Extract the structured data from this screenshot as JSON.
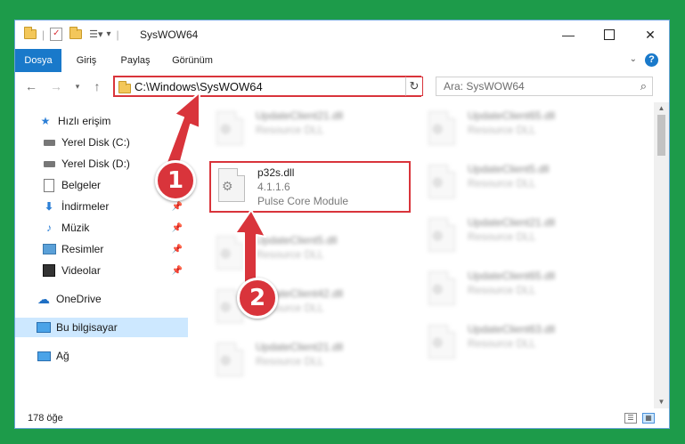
{
  "window": {
    "title": "SysWOW64"
  },
  "ribbon": {
    "tabs": [
      "Dosya",
      "Giriş",
      "Paylaş",
      "Görünüm"
    ],
    "help": "?"
  },
  "address": {
    "path": "C:\\Windows\\SysWOW64"
  },
  "search": {
    "placeholder": "Ara: SysWOW64"
  },
  "sidebar": {
    "items": [
      {
        "label": "Hızlı erişim",
        "icon": "star-icon"
      },
      {
        "label": "Yerel Disk (C:)",
        "icon": "drive-icon"
      },
      {
        "label": "Yerel Disk (D:)",
        "icon": "drive-icon"
      },
      {
        "label": "Belgeler",
        "icon": "documents-icon"
      },
      {
        "label": "İndirmeler",
        "icon": "download-icon"
      },
      {
        "label": "Müzik",
        "icon": "music-icon"
      },
      {
        "label": "Resimler",
        "icon": "pictures-icon"
      },
      {
        "label": "Videolar",
        "icon": "video-icon"
      },
      {
        "label": "OneDrive",
        "icon": "cloud-icon"
      },
      {
        "label": "Bu bilgisayar",
        "icon": "computer-icon"
      },
      {
        "label": "Ağ",
        "icon": "network-icon"
      }
    ]
  },
  "files": {
    "highlighted": {
      "name": "p32s.dll",
      "version": "4.1.1.6",
      "description": "Pulse Core Module"
    },
    "left": [
      {
        "name": "UpdateClient21.dll",
        "type": "Resource DLL"
      },
      {
        "name": "UpdateClient5.dll",
        "type": "Resource DLL"
      },
      {
        "name": "UpdateClient42.dll",
        "type": "Resource DLL"
      },
      {
        "name": "UpdateClient21.dll",
        "type": "Resource DLL"
      }
    ],
    "right": [
      {
        "name": "UpdateClient65.dll",
        "type": "Resource DLL"
      },
      {
        "name": "UpdateClient5.dll",
        "type": "Resource DLL"
      },
      {
        "name": "UpdateClient21.dll",
        "type": "Resource DLL"
      },
      {
        "name": "UpdateClient65.dll",
        "type": "Resource DLL"
      },
      {
        "name": "UpdateClient63.dll",
        "type": "Resource DLL"
      }
    ]
  },
  "status": {
    "count": "178 öğe"
  },
  "annotations": {
    "step1": "1",
    "step2": "2",
    "color": "#d9343b"
  }
}
